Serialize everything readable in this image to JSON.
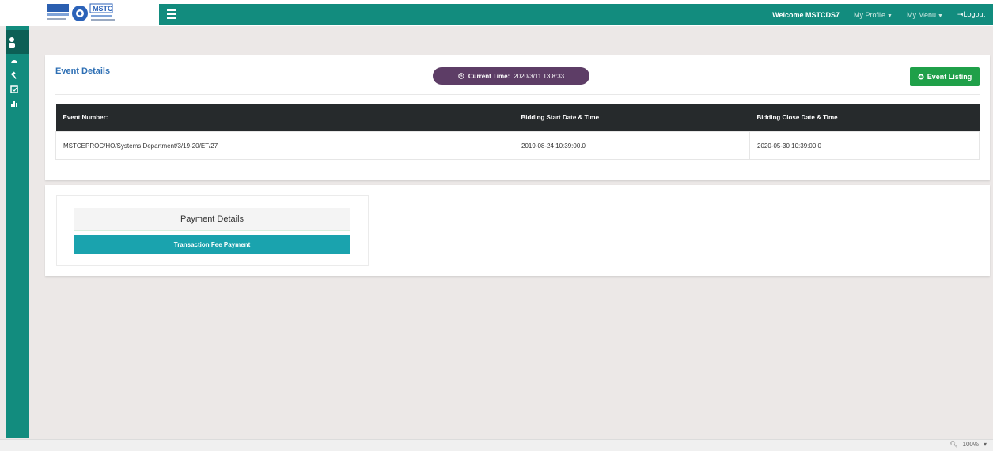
{
  "header": {
    "welcome": "Welcome MSTCDS7",
    "my_profile": "My Profile",
    "my_menu": "My Menu",
    "logout": "Logout",
    "logo_text": "MSTC"
  },
  "event_details": {
    "title": "Event Details",
    "current_time_label": "Current Time:",
    "current_time_value": "2020/3/11 13:8:33",
    "event_listing_button": "Event Listing",
    "table": {
      "headers": [
        "Event Number:",
        "Bidding Start Date & Time",
        "Bidding Close Date & Time"
      ],
      "rows": [
        [
          "MSTCEPROC/HO/Systems Department/3/19-20/ET/27",
          "2019-08-24 10:39:00.0",
          "2020-05-30 10:39:00.0"
        ]
      ]
    }
  },
  "payment": {
    "title": "Payment Details",
    "button": "Transaction Fee Payment"
  },
  "status": {
    "zoom": "100%"
  },
  "colors": {
    "brand_green": "#128c7e",
    "pill_purple": "#5d3d66",
    "button_green": "#1fa049",
    "button_teal": "#1aa3ae"
  }
}
